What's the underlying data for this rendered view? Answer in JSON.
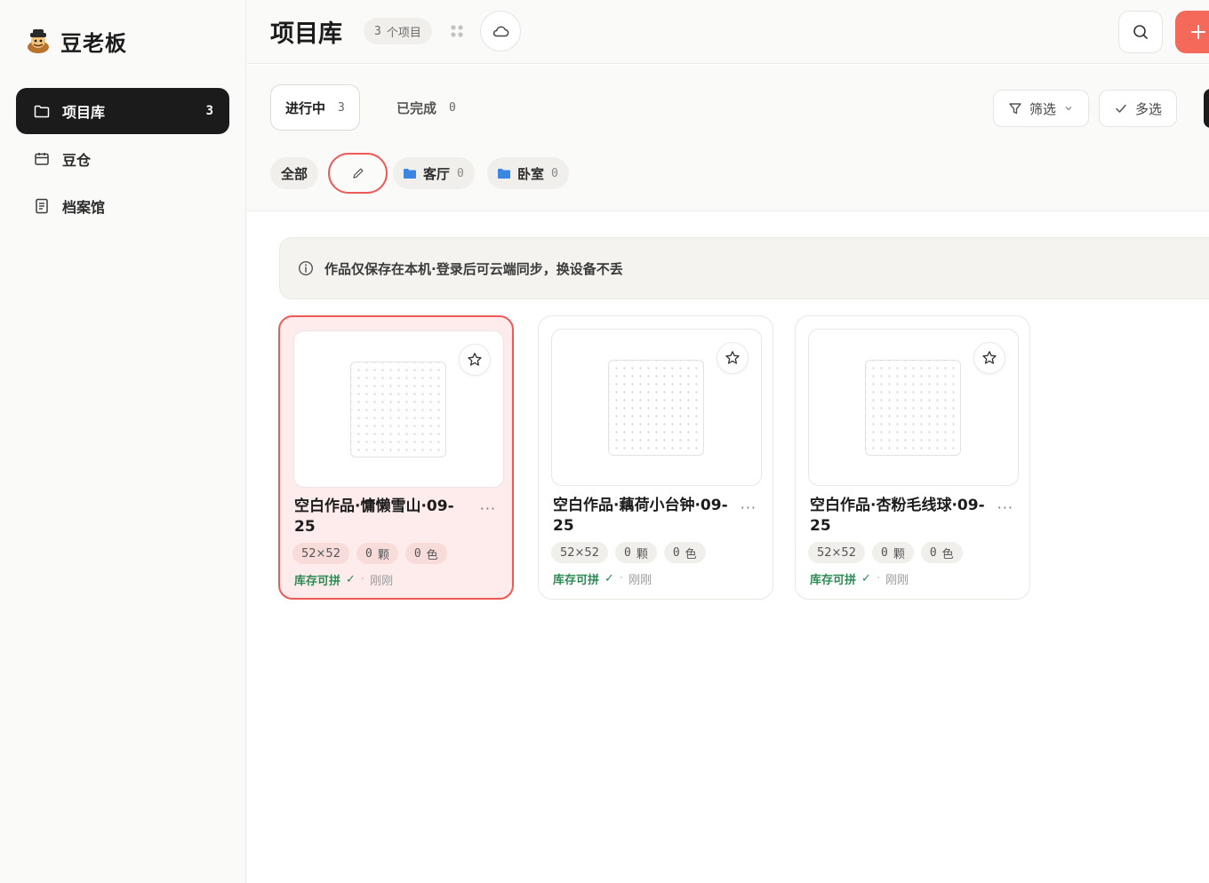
{
  "app": {
    "name": "豆老板"
  },
  "sidebar": {
    "items": [
      {
        "label": "项目库",
        "count": "3",
        "active": true,
        "icon": "folder-icon"
      },
      {
        "label": "豆仓",
        "count": "",
        "active": false,
        "icon": "calendar-box-icon"
      },
      {
        "label": "档案馆",
        "count": "",
        "active": false,
        "icon": "document-icon"
      }
    ]
  },
  "header": {
    "title": "项目库",
    "count_number": "3",
    "count_unit": "个项目"
  },
  "tabs": [
    {
      "label": "进行中",
      "count": "3",
      "active": true
    },
    {
      "label": "已完成",
      "count": "0",
      "active": false
    }
  ],
  "toolbar": {
    "filter_label": "筛选",
    "multiselect_label": "多选"
  },
  "chips": [
    {
      "label": "全部",
      "count": ""
    },
    {
      "label": "客厅",
      "count": "0"
    },
    {
      "label": "卧室",
      "count": "0"
    }
  ],
  "notice": {
    "text": "作品仅保存在本机·登录后可云端同步，换设备不丢"
  },
  "projects": [
    {
      "title": "空白作品·慵懒雪山·09-25",
      "size": "52×52",
      "beads_count": "0",
      "beads_unit": "颗",
      "colors_count": "0",
      "colors_unit": "色",
      "stock_status": "库存可拼",
      "check": "✓",
      "time": "刚刚",
      "selected": true
    },
    {
      "title": "空白作品·藕荷小台钟·09-25",
      "size": "52×52",
      "beads_count": "0",
      "beads_unit": "颗",
      "colors_count": "0",
      "colors_unit": "色",
      "stock_status": "库存可拼",
      "check": "✓",
      "time": "刚刚",
      "selected": false
    },
    {
      "title": "空白作品·杏粉毛线球·09-25",
      "size": "52×52",
      "beads_count": "0",
      "beads_unit": "颗",
      "colors_count": "0",
      "colors_unit": "色",
      "stock_status": "库存可拼",
      "check": "✓",
      "time": "刚刚",
      "selected": false
    }
  ],
  "colors": {
    "accent": "#ee5a55",
    "add_button": "#f4695a",
    "nav_active": "#1b1b1b",
    "stock_ok": "#2d8a55",
    "folder": "#3a86e0"
  }
}
